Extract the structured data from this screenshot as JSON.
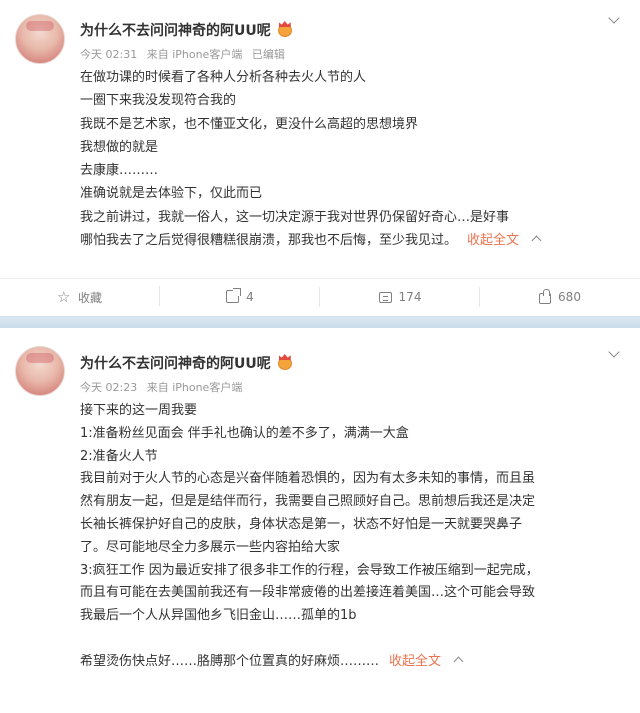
{
  "posts": [
    {
      "username": "为什么不去问问神奇的阿UU呢",
      "badge_icon": "vip-crown-badge-icon",
      "meta": {
        "time": "今天 02:31",
        "source": "来自 iPhone客户端",
        "edited": "已编辑"
      },
      "lines": [
        "在做功课的时候看了各种人分析各种去火人节的人",
        "一圈下来我没发现符合我的",
        "我既不是艺术家，也不懂亚文化，更没什么高超的思想境界",
        "我想做的就是",
        "去康康………",
        "准确说就是去体验下，仅此而已",
        "我之前讲过，我就一俗人，这一切决定源于我对世界仍保留好奇心…是好事",
        "哪怕我去了之后觉得很糟糕很崩溃，那我也不后悔，至少我见过。"
      ],
      "collapse_label": "收起全文",
      "actions": {
        "favorite": "收藏",
        "repost": "4",
        "comment": "174",
        "like": "680"
      }
    },
    {
      "username": "为什么不去问问神奇的阿UU呢",
      "badge_icon": "vip-crown-badge-icon",
      "meta": {
        "time": "今天 02:23",
        "source": "来自 iPhone客户端"
      },
      "lines": [
        "接下来的这一周我要",
        "1:准备粉丝见面会 伴手礼也确认的差不多了，满满一大盒",
        "2:准备火人节",
        "我目前对于火人节的心态是兴奋伴随着恐惧的，因为有太多未知的事情，而且虽",
        "然有朋友一起，但是是结伴而行，我需要自己照顾好自己。思前想后我还是决定",
        "长袖长裤保护好自己的皮肤，身体状态是第一，状态不好怕是一天就要哭鼻子",
        "了。尽可能地尽全力多展示一些内容拍给大家",
        "3:疯狂工作 因为最近安排了很多非工作的行程，会导致工作被压缩到一起完成，",
        "而且有可能在去美国前我还有一段非常疲倦的出差接连着美国…这个可能会导致",
        "我最后一个人从异国他乡飞旧金山……孤单的1b",
        "",
        "希望烫伤快点好……胳膊那个位置真的好麻烦………"
      ],
      "collapse_label": "收起全文"
    }
  ],
  "colors": {
    "link_orange": "#eb7350",
    "meta_gray": "#999999",
    "text": "#333333",
    "divider_blue": "#d2e0ea"
  }
}
